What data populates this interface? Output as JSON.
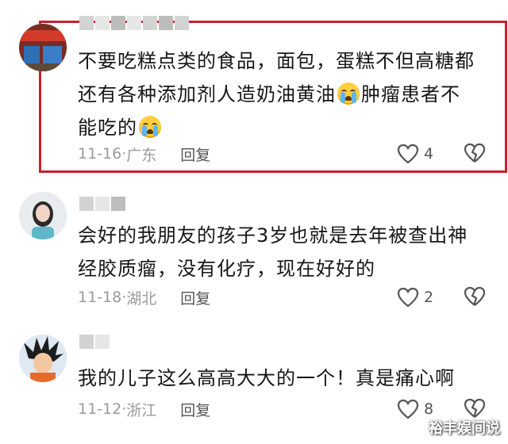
{
  "comments": [
    {
      "text_a": "不要吃糕点类的食品，面包，蛋糕不但高糖都还有各种添加剂人造奶油黄油",
      "text_b": "肿瘤患者不能吃的",
      "date": "11-16",
      "location": "广东",
      "reply": "回复",
      "likes": "4"
    },
    {
      "text": "会好的我朋友的孩子3岁也就是去年被查出神经胶质瘤，没有化疗，现在好好的",
      "date": "11-18",
      "location": "湖北",
      "reply": "回复",
      "likes": "2"
    },
    {
      "text": "我的儿子这么高高大大的一个！真是痛心啊",
      "date": "11-12",
      "location": "浙江",
      "reply": "回复",
      "likes": "8"
    }
  ],
  "watermark": "裕丰娱间说",
  "highlight_color": "#c91f2d",
  "icons": [
    "heart-icon",
    "broken-heart-icon",
    "crying-face-emoji"
  ]
}
